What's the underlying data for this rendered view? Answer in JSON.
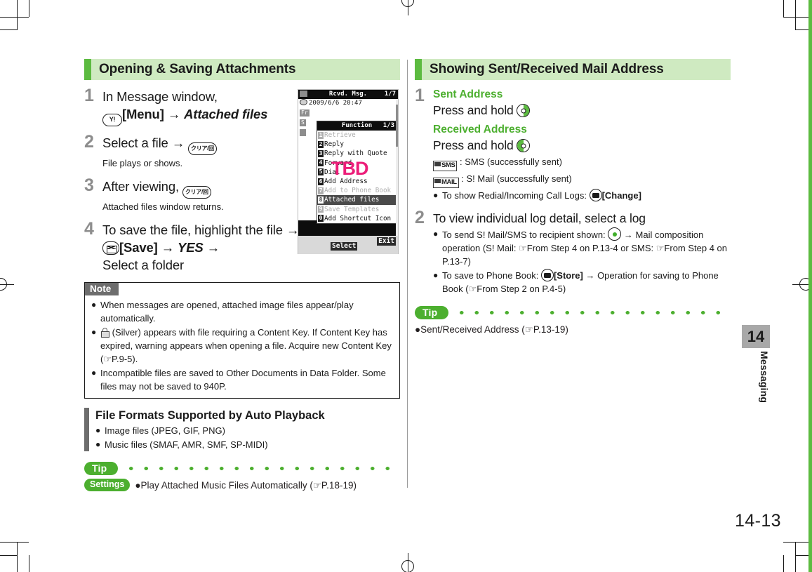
{
  "document": {
    "page_number": "14-13",
    "chapter_number": "14",
    "chapter_label": "Messaging"
  },
  "left_column": {
    "section_title": "Opening & Saving Attachments",
    "steps": [
      {
        "num": "1",
        "lead_a": "In Message window,",
        "key": "Y!",
        "lead_b": "[Menu]",
        "arrow": "→",
        "lead_c": "Attached files"
      },
      {
        "num": "2",
        "lead_a": "Select a file",
        "arrow": "→",
        "key": "クリア/回",
        "sub": "File plays or shows."
      },
      {
        "num": "3",
        "lead_a": "After viewing,",
        "key": "クリア/回",
        "sub": "Attached files window returns."
      },
      {
        "num": "4",
        "lead_a": "To save the file, highlight the file",
        "arrow": "→",
        "lead_b": "[Save]",
        "arrow2": "→",
        "lead_c": "YES",
        "arrow3": "→",
        "lead_d": "Select a folder"
      }
    ],
    "note": {
      "heading": "Note",
      "items": [
        "When messages are opened, attached image files appear/play automatically.",
        "(Silver) appears with file requiring a Content Key. If Content Key has expired, warning appears when opening a file. Acquire new Content Key (☞P.9-5).",
        "Incompatible files are saved to Other Documents in Data Folder. Some files may not be saved to 940P."
      ]
    },
    "formats_section": {
      "title": "File Formats Supported by Auto Playback",
      "items": [
        "Image files (JPEG, GIF, PNG)",
        "Music files (SMAF, AMR, SMF, SP-MIDI)"
      ]
    },
    "tip": {
      "label": "Tip",
      "tag": "Settings",
      "text": "●Play Attached Music Files Automatically (☞P.18-19)"
    }
  },
  "right_column": {
    "section_title": "Showing Sent/Received Mail Address",
    "steps": [
      {
        "num": "1",
        "sent_heading": "Sent Address",
        "sent_action": "Press and hold",
        "received_heading": "Received Address",
        "received_action": "Press and hold",
        "legend": [
          {
            "badge": "SMS",
            "text": ": SMS (successfully sent)"
          },
          {
            "badge": "MAIL",
            "text": ": S! Mail (successfully sent)"
          }
        ],
        "bullet_a": "To show Redial/Incoming Call Logs:",
        "bullet_a_key": "[Change]"
      },
      {
        "num": "2",
        "lead": "To view individual log detail, select a log",
        "bullets": [
          "To send S! Mail/SMS to recipient shown: ● → Mail composition operation (S! Mail: ☞From Step 4 on P.13-4 or SMS: ☞From Step 4 on P.13-7)",
          "To save to Phone Book: ⌘[Store] → Operation for saving to Phone Book (☞From Step 2 on P.4-5)"
        ],
        "b2_pre": "To send S! Mail/SMS to recipient shown:",
        "b2_post": "→ Mail composition operation (S! Mail: ☞From Step 4 on P.13-4 or SMS: ☞From Step 4 on P.13-7)",
        "b3_pre": "To save to Phone Book:",
        "b3_key": "[Store]",
        "b3_post": "→ Operation for saving to Phone Book (☞From Step 2 on P.4-5)"
      }
    ],
    "tip": {
      "label": "Tip",
      "text": "●Sent/Received Address (☞P.13-19)"
    }
  },
  "phone_mock": {
    "title": "Rcvd. Msg.",
    "title_counter": "1/7",
    "timestamp": "2009/6/6  20:47",
    "rows": [
      {
        "tag": "Fr",
        "text": ""
      },
      {
        "tag": "S",
        "text": ""
      }
    ],
    "menu_title": "Function",
    "menu_counter": "1/3",
    "menu_items": [
      {
        "key": "1",
        "label": "Retrieve",
        "state": "dim"
      },
      {
        "key": "2",
        "label": "Reply",
        "state": "normal"
      },
      {
        "key": "3",
        "label": "Reply with Quote",
        "state": "normal"
      },
      {
        "key": "4",
        "label": "Forward",
        "state": "normal"
      },
      {
        "key": "5",
        "label": "Dial",
        "state": "normal"
      },
      {
        "key": "6",
        "label": "Add Address",
        "state": "normal"
      },
      {
        "key": "7",
        "label": "Add to Phone Book",
        "state": "dim"
      },
      {
        "key": "8",
        "label": "Attached files",
        "state": "selected"
      },
      {
        "key": "9",
        "label": "Save Templates",
        "state": "dim"
      },
      {
        "key": "0",
        "label": "Add Shortcut Icon",
        "state": "normal"
      }
    ],
    "overlay_text": "TBD",
    "softkey_left": "Select",
    "softkey_right": "Exit"
  },
  "colors": {
    "accent_green": "#4caf2f",
    "header_bg": "#cfeac1",
    "header_accent": "#5cbb40",
    "gray_bar": "#6d6d6d",
    "tbd_magenta": "#ec1e79"
  }
}
